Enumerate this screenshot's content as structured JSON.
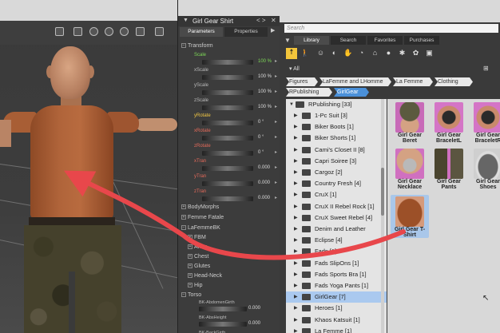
{
  "params": {
    "title": "Girl Gear Shirt",
    "tabs": [
      "Parameters",
      "Properties"
    ],
    "transform_group": "Transform",
    "rows": [
      {
        "label": "Scale",
        "value": "100 %",
        "style": "green"
      },
      {
        "label": "xScale",
        "value": "100 %",
        "style": ""
      },
      {
        "label": "yScale",
        "value": "100 %",
        "style": ""
      },
      {
        "label": "zScale",
        "value": "100 %",
        "style": ""
      },
      {
        "label": "yRotate",
        "value": "0 °",
        "style": "yellow"
      },
      {
        "label": "xRotate",
        "value": "0 °",
        "style": "red"
      },
      {
        "label": "zRotate",
        "value": "0 °",
        "style": "red"
      },
      {
        "label": "xTran",
        "value": "0.000",
        "style": "red"
      },
      {
        "label": "yTran",
        "value": "0.000",
        "style": "red"
      },
      {
        "label": "zTran",
        "value": "0.000",
        "style": "red"
      }
    ],
    "groups": [
      "BodyMorphs",
      "Femme Fatale",
      "LaFemmeBK",
      "FBM",
      "Arms",
      "Chest",
      "Glutes",
      "Head-Neck",
      "Hip",
      "Torso"
    ],
    "sub_rows": [
      {
        "label": "BK-AbdomenGirth",
        "value": "0.000"
      },
      {
        "label": "BK-AbsHeight",
        "value": "0.000"
      },
      {
        "label": "BK-BackGirth",
        "value": ""
      }
    ]
  },
  "library": {
    "search_placeholder": "Search",
    "tabs": [
      "Library",
      "Search",
      "Favorites",
      "Purchases"
    ],
    "all_label": "All",
    "breadcrumbs": [
      "Figures",
      "LaFemme and LHomme",
      "La Femme",
      "Clothing"
    ],
    "breadcrumbs2": [
      "RPublishing",
      "GirlGear"
    ],
    "tree_root": "RPublishing [33]",
    "tree": [
      "1-Pc Suit [3]",
      "Biker Boots [1]",
      "Biker Shorts [1]",
      "Cami's Closet II [8]",
      "Capri Soiree [3]",
      "Cargoz [2]",
      "Country Fresh [4]",
      "CruX [1]",
      "CruX II Rebel Rock [1]",
      "CruX Sweet Rebel [4]",
      "Denim and Leather",
      "Eclipse [4]",
      "Fads [1]",
      "Fads SlipOns [1]",
      "Fads Sports Bra [1]",
      "Fads Yoga Pants [1]",
      "GirlGear [7]",
      "Heroes [1]",
      "Khaos Katsuit [1]",
      "La Femme [1]"
    ],
    "selected_tree_index": 16,
    "thumbnails": [
      {
        "label": "Girl Gear Beret",
        "selected": false
      },
      {
        "label": "Girl Gear BraceletL",
        "selected": false
      },
      {
        "label": "Girl Gear BraceletR",
        "selected": false
      },
      {
        "label": "Girl Gear Necklace",
        "selected": false
      },
      {
        "label": "Girl Gear Pants",
        "selected": false
      },
      {
        "label": "Girl Gear Shoes",
        "selected": false
      },
      {
        "label": "Girl Gear T-Shirt",
        "selected": true
      }
    ]
  },
  "colors": {
    "arrow": "#e8474b",
    "selection": "#aac9ef",
    "highlight": "#f3c53b"
  }
}
